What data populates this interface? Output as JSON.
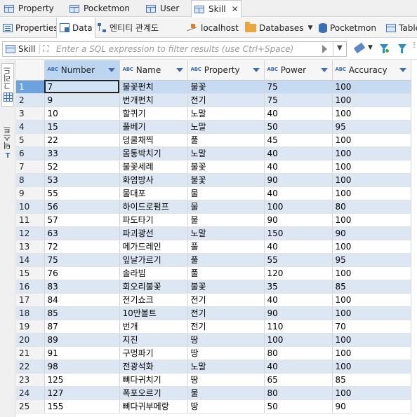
{
  "editor_tabs": [
    {
      "label": "Property",
      "active": false,
      "closable": false
    },
    {
      "label": "Pocketmon",
      "active": false,
      "closable": false
    },
    {
      "label": "User",
      "active": false,
      "closable": false
    },
    {
      "label": "Skill",
      "active": true,
      "closable": true
    }
  ],
  "sub_tabs": {
    "properties": "Properties",
    "data": "Data",
    "er_diagram": "엔티티 관계도"
  },
  "breadcrumb": {
    "connection": "localhost",
    "databases": "Databases",
    "database": "Pocketmon",
    "tables": "Table"
  },
  "filter": {
    "table_label": "Skill",
    "placeholder": "Enter a SQL expression to filter results (use Ctrl+Space)"
  },
  "left_panel": {
    "grid_label": "그리드",
    "text_label": "텍스트"
  },
  "grid": {
    "type_badge": "ABC",
    "columns": [
      "Number",
      "Name",
      "Property",
      "Power",
      "Accuracy"
    ],
    "sorted_column": "Number",
    "selected_row": 1,
    "rows": [
      [
        "7",
        "불꽃펀치",
        "불꽃",
        "75",
        "100"
      ],
      [
        "9",
        "번개펀치",
        "전기",
        "75",
        "100"
      ],
      [
        "10",
        "할퀴기",
        "노말",
        "40",
        "100"
      ],
      [
        "15",
        "풀베기",
        "노말",
        "50",
        "95"
      ],
      [
        "22",
        "덩쿨채찍",
        "풀",
        "45",
        "100"
      ],
      [
        "33",
        "몸통박치기",
        "노말",
        "40",
        "100"
      ],
      [
        "52",
        "불꽃세례",
        "불꽃",
        "40",
        "100"
      ],
      [
        "53",
        "화염방사",
        "불꽃",
        "90",
        "100"
      ],
      [
        "55",
        "물대포",
        "물",
        "40",
        "100"
      ],
      [
        "56",
        "하이드로펌프",
        "물",
        "100",
        "80"
      ],
      [
        "57",
        "파도타기",
        "물",
        "90",
        "100"
      ],
      [
        "63",
        "파괴광선",
        "노말",
        "150",
        "90"
      ],
      [
        "72",
        "메가드레인",
        "풀",
        "40",
        "100"
      ],
      [
        "75",
        "잎날가르기",
        "풀",
        "55",
        "95"
      ],
      [
        "76",
        "솔라빔",
        "풀",
        "120",
        "100"
      ],
      [
        "83",
        "회오리불꽃",
        "불꽃",
        "35",
        "85"
      ],
      [
        "84",
        "전기쇼크",
        "전기",
        "40",
        "100"
      ],
      [
        "85",
        "10만볼트",
        "전기",
        "90",
        "100"
      ],
      [
        "87",
        "번개",
        "전기",
        "110",
        "70"
      ],
      [
        "89",
        "지진",
        "땅",
        "100",
        "100"
      ],
      [
        "91",
        "구멍파기",
        "땅",
        "80",
        "100"
      ],
      [
        "98",
        "전광석화",
        "노말",
        "40",
        "100"
      ],
      [
        "125",
        "뼈다귀치기",
        "땅",
        "65",
        "85"
      ],
      [
        "127",
        "폭포오르기",
        "물",
        "80",
        "100"
      ],
      [
        "155",
        "뼈다귀부메랑",
        "땅",
        "50",
        "90"
      ]
    ]
  },
  "colors": {
    "alt_row": "#dde7f4",
    "selected_row": "#c6daf1",
    "sorted_header": "#bcd6f1",
    "accent": "#3c6ea8"
  }
}
